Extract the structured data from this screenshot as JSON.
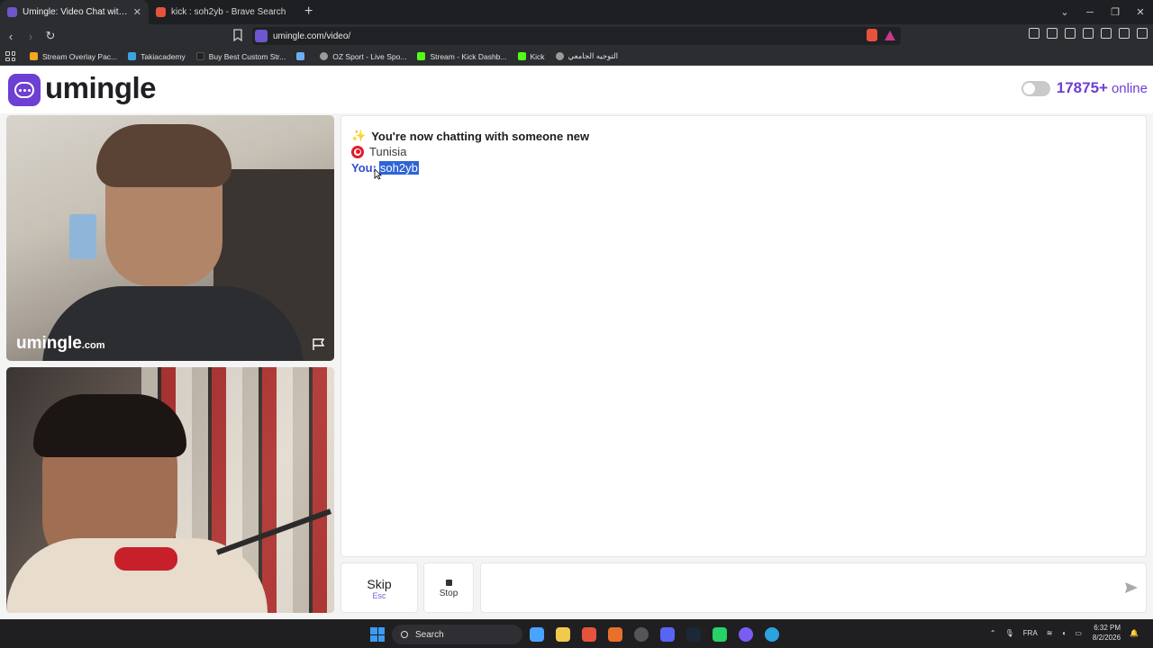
{
  "browser": {
    "tabs": [
      {
        "title": "Umingle: Video Chat with Str",
        "active": true,
        "favicon_color": "#6e56cf"
      },
      {
        "title": "kick : soh2yb - Brave Search",
        "active": false,
        "favicon_color": "#e5533d"
      }
    ],
    "new_tab": "+",
    "url": "umingle.com/video/",
    "bookmarks": [
      {
        "label": "Stream Overlay Pac...",
        "color": "#f5a623"
      },
      {
        "label": "Takiacademy",
        "color": "#3ba3e0"
      },
      {
        "label": "Buy Best Custom Str...",
        "color": "#222222"
      },
      {
        "label": "",
        "color": "#6ab0f3"
      },
      {
        "label": "OZ Sport - Live Spo...",
        "color": "#9a9a9a"
      },
      {
        "label": "Stream - Kick Dashb...",
        "color": "#53fc18"
      },
      {
        "label": "Kick",
        "color": "#53fc18"
      },
      {
        "label": "التوجيه الجامعي",
        "color": "#9a9a9a"
      }
    ]
  },
  "site": {
    "logo_text": "umingle",
    "brand_color": "#6d3fd2",
    "online_count": "17875+",
    "online_label": "online"
  },
  "videos": {
    "watermark_main": "umingle",
    "watermark_domain": ".com"
  },
  "chat": {
    "system_message": "You're now chatting with someone new",
    "country": "Tunisia",
    "you_label": "You:",
    "you_message": "soh2yb"
  },
  "controls": {
    "skip_label": "Skip",
    "skip_shortcut": "Esc",
    "stop_label": "Stop",
    "message_placeholder": ""
  },
  "taskbar": {
    "search_label": "Search",
    "language": "FRA",
    "time": "6:32 PM",
    "date": "8/2/2026"
  }
}
